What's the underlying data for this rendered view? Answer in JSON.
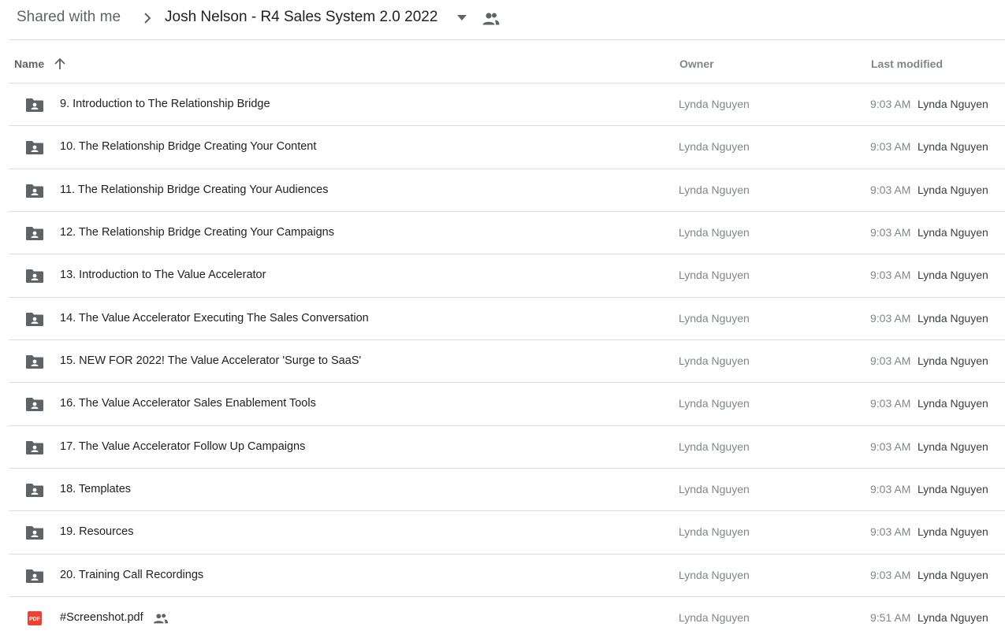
{
  "breadcrumb": {
    "root": "Shared with me",
    "current": "Josh Nelson - R4 Sales System 2.0 2022"
  },
  "columns": {
    "name": "Name",
    "owner": "Owner",
    "last_modified": "Last modified"
  },
  "icons": {
    "breadcrumb_separator": "chevron-right-icon",
    "folder_menu": "arrow-drop-down-icon",
    "shared": "people-icon",
    "sort": "arrow-up-icon",
    "shared_folder": "shared-folder-icon",
    "pdf": "pdf-icon"
  },
  "colors": {
    "folder_icon": "#5f6368",
    "pdf_icon": "#ea4335",
    "divider": "#dadce0"
  },
  "rows": [
    {
      "name": "9. Introduction to The Relationship Bridge",
      "type": "folder",
      "owner": "Lynda Nguyen",
      "time": "9:03 AM",
      "modifier": "Lynda Nguyen"
    },
    {
      "name": "10. The Relationship Bridge Creating Your Content",
      "type": "folder",
      "owner": "Lynda Nguyen",
      "time": "9:03 AM",
      "modifier": "Lynda Nguyen"
    },
    {
      "name": "11. The Relationship Bridge Creating Your Audiences",
      "type": "folder",
      "owner": "Lynda Nguyen",
      "time": "9:03 AM",
      "modifier": "Lynda Nguyen"
    },
    {
      "name": "12. The Relationship Bridge Creating Your Campaigns",
      "type": "folder",
      "owner": "Lynda Nguyen",
      "time": "9:03 AM",
      "modifier": "Lynda Nguyen"
    },
    {
      "name": "13. Introduction to The Value Accelerator",
      "type": "folder",
      "owner": "Lynda Nguyen",
      "time": "9:03 AM",
      "modifier": "Lynda Nguyen"
    },
    {
      "name": "14. The Value Accelerator Executing The Sales Conversation",
      "type": "folder",
      "owner": "Lynda Nguyen",
      "time": "9:03 AM",
      "modifier": "Lynda Nguyen"
    },
    {
      "name": "15. NEW FOR 2022! The Value Accelerator 'Surge to SaaS'",
      "type": "folder",
      "owner": "Lynda Nguyen",
      "time": "9:03 AM",
      "modifier": "Lynda Nguyen"
    },
    {
      "name": "16. The Value Accelerator Sales Enablement Tools",
      "type": "folder",
      "owner": "Lynda Nguyen",
      "time": "9:03 AM",
      "modifier": "Lynda Nguyen"
    },
    {
      "name": "17. The Value Accelerator Follow Up Campaigns",
      "type": "folder",
      "owner": "Lynda Nguyen",
      "time": "9:03 AM",
      "modifier": "Lynda Nguyen"
    },
    {
      "name": "18. Templates",
      "type": "folder",
      "owner": "Lynda Nguyen",
      "time": "9:03 AM",
      "modifier": "Lynda Nguyen"
    },
    {
      "name": "19. Resources",
      "type": "folder",
      "owner": "Lynda Nguyen",
      "time": "9:03 AM",
      "modifier": "Lynda Nguyen"
    },
    {
      "name": "20. Training Call Recordings",
      "type": "folder",
      "owner": "Lynda Nguyen",
      "time": "9:03 AM",
      "modifier": "Lynda Nguyen"
    },
    {
      "name": "#Screenshot.pdf",
      "type": "pdf",
      "pdf_label": "PDF",
      "shared": true,
      "owner": "Lynda Nguyen",
      "time": "9:51 AM",
      "modifier": "Lynda Nguyen"
    }
  ]
}
